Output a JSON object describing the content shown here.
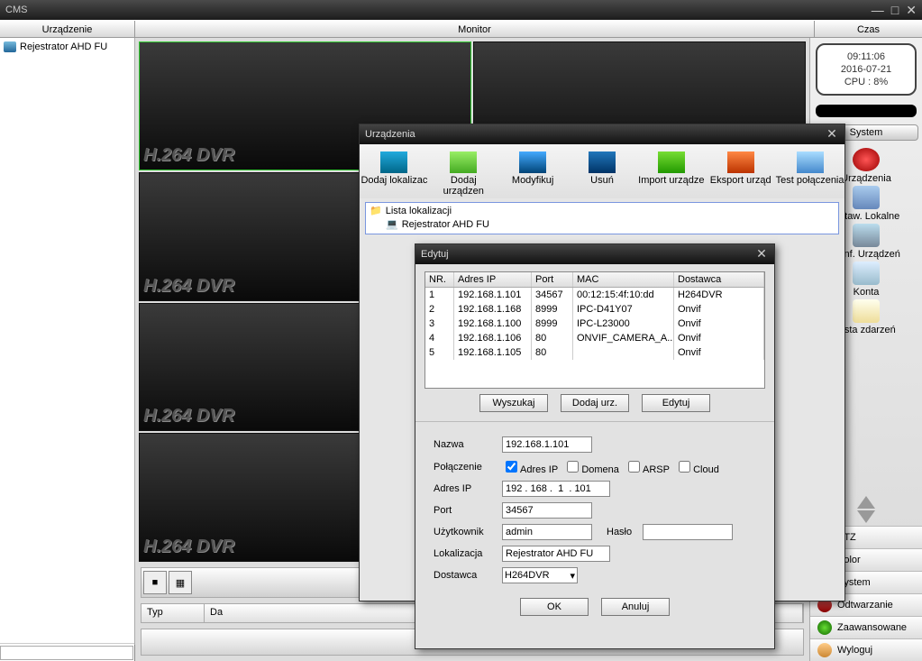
{
  "app": {
    "title": "CMS"
  },
  "sections": {
    "left": "Urządzenie",
    "mid": "Monitor",
    "right": "Czas"
  },
  "tree": {
    "root": "Rejestrator AHD FU"
  },
  "clock": {
    "time": "09:11:06",
    "date": "2016-07-21",
    "cpu": "CPU : 8%"
  },
  "system_header": "System",
  "sys_items": {
    "devices": "Urządzenia",
    "local_settings": "Ustaw. Lokalne",
    "dev_conf": "Konf. Urządzeń",
    "accounts": "Konta",
    "events": "Lista zdarzeń"
  },
  "typ_row": {
    "typ": "Typ",
    "da": "Da"
  },
  "dvr_watermark": "H.264 DVR",
  "side_tabs": {
    "ptz": "PTZ",
    "color": "Kolor",
    "system": "System",
    "playback": "Odtwarzanie",
    "advanced": "Zaawansowane",
    "logout": "Wyloguj"
  },
  "dlg1": {
    "title": "Urządzenia",
    "tools": {
      "add_loc": "Dodaj lokalizac",
      "add_dev": "Dodaj urządzen",
      "modify": "Modyfikuj",
      "delete": "Usuń",
      "import": "Import urządze",
      "export": "Eksport urząd",
      "test": "Test połączenia"
    },
    "list_header": "Lista lokalizacji",
    "list_item": "Rejestrator AHD FU"
  },
  "dlg2": {
    "title": "Edytuj",
    "cols": {
      "nr": "NR.",
      "ip": "Adres IP",
      "port": "Port",
      "mac": "MAC",
      "dost": "Dostawca"
    },
    "rows": [
      {
        "nr": "1",
        "ip": "192.168.1.101",
        "port": "34567",
        "mac": "00:12:15:4f:10:dd",
        "dost": "H264DVR"
      },
      {
        "nr": "2",
        "ip": "192.168.1.168",
        "port": "8999",
        "mac": "IPC-D41Y07",
        "dost": "Onvif"
      },
      {
        "nr": "3",
        "ip": "192.168.1.100",
        "port": "8999",
        "mac": "IPC-L23000",
        "dost": "Onvif"
      },
      {
        "nr": "4",
        "ip": "192.168.1.106",
        "port": "80",
        "mac": "ONVIF_CAMERA_A...",
        "dost": "Onvif"
      },
      {
        "nr": "5",
        "ip": "192.168.1.105",
        "port": "80",
        "mac": "",
        "dost": "Onvif"
      }
    ],
    "buttons": {
      "search": "Wyszukaj",
      "add": "Dodaj urz.",
      "edit": "Edytuj",
      "ok": "OK",
      "cancel": "Anuluj"
    },
    "labels": {
      "name": "Nazwa",
      "connection": "Połączenie",
      "address": "Adres IP",
      "port": "Port",
      "user": "Użytkownik",
      "pass": "Hasło",
      "location": "Lokalizacja",
      "vendor": "Dostawca"
    },
    "conn_opts": {
      "ip": "Adres IP",
      "domain": "Domena",
      "arsp": "ARSP",
      "cloud": "Cloud"
    },
    "form": {
      "name": "192.168.1.101",
      "address": "192 . 168 .  1  . 101",
      "port": "34567",
      "user": "admin",
      "pass": "",
      "location": "Rejestrator AHD FU",
      "vendor": "H264DVR"
    }
  }
}
